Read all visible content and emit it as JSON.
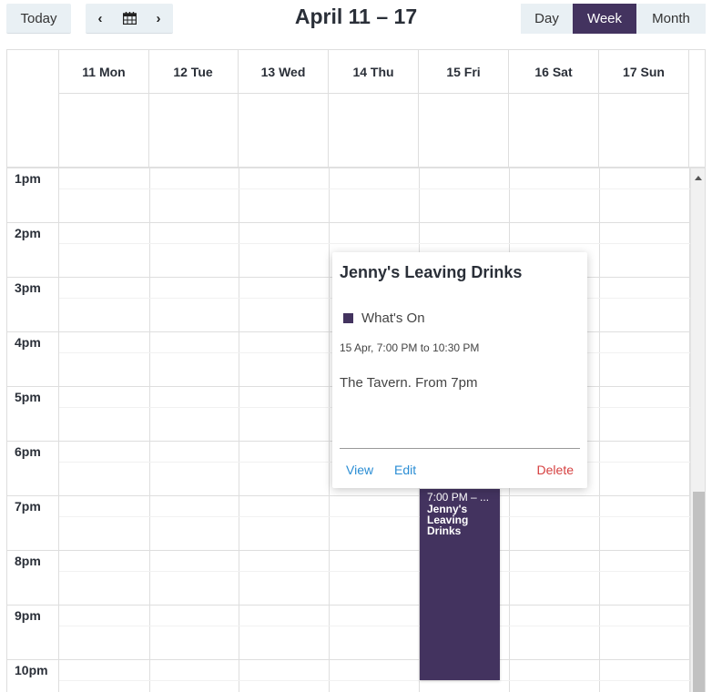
{
  "toolbar": {
    "today_label": "Today",
    "prev_icon": "chevron-left-icon",
    "calendar_icon": "calendar-icon",
    "next_icon": "chevron-right-icon",
    "title": "April 11 – 17",
    "views": [
      {
        "label": "Day",
        "active": false
      },
      {
        "label": "Week",
        "active": true
      },
      {
        "label": "Month",
        "active": false
      }
    ]
  },
  "calendar": {
    "days": [
      "11 Mon",
      "12 Tue",
      "13 Wed",
      "14 Thu",
      "15 Fri",
      "16 Sat",
      "17 Sun"
    ],
    "hours": [
      "1pm",
      "2pm",
      "3pm",
      "4pm",
      "5pm",
      "6pm",
      "7pm",
      "8pm",
      "9pm",
      "10pm"
    ],
    "accent_color": "#43335f"
  },
  "event": {
    "time_short": "7:00 PM – ...",
    "title": "Jenny's Leaving Drinks"
  },
  "popover": {
    "title": "Jenny's Leaving Drinks",
    "calendar_name": "What's On",
    "datetime": "15 Apr, 7:00 PM to 10:30 PM",
    "description": "The Tavern. From 7pm",
    "view_label": "View",
    "edit_label": "Edit",
    "delete_label": "Delete"
  }
}
